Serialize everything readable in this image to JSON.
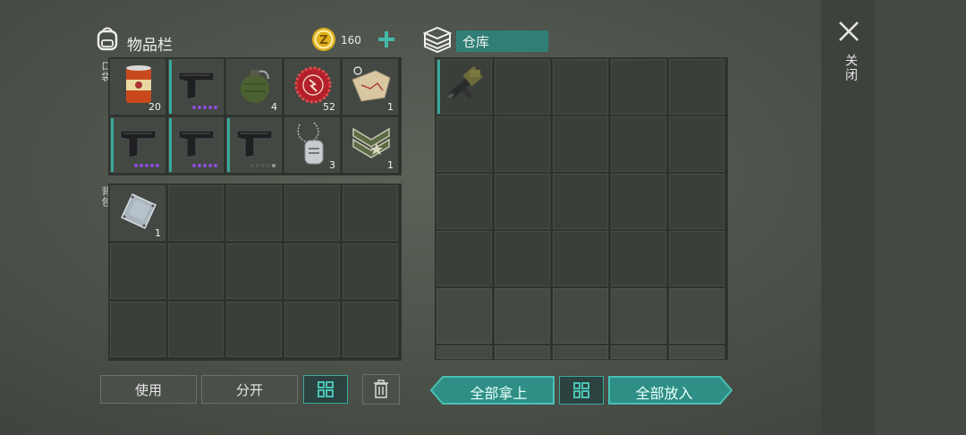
{
  "inventory": {
    "title": "物品栏",
    "coins": "160",
    "pocket_label": "口袋",
    "backpack_label": "背包",
    "pocket_slots": [
      {
        "item": "canned-food",
        "qty": "20",
        "selected": false,
        "dots": []
      },
      {
        "item": "pistol",
        "qty": "",
        "selected": true,
        "dots": [
          "#8a4fd8",
          "#8a4fd8",
          "#8a4fd8",
          "#8a4fd8",
          "#8a4fd8"
        ]
      },
      {
        "item": "grenade",
        "qty": "4",
        "selected": false,
        "dots": []
      },
      {
        "item": "bottle-cap",
        "qty": "52",
        "selected": false,
        "dots": []
      },
      {
        "item": "map-fragment",
        "qty": "1",
        "selected": false,
        "dots": []
      },
      {
        "item": "pistol",
        "qty": "",
        "selected": true,
        "dots": [
          "#8a4fd8",
          "#8a4fd8",
          "#8a4fd8",
          "#8a4fd8",
          "#8a4fd8"
        ]
      },
      {
        "item": "pistol",
        "qty": "",
        "selected": true,
        "dots": [
          "#8a4fd8",
          "#8a4fd8",
          "#8a4fd8",
          "#8a4fd8",
          "#8a4fd8"
        ]
      },
      {
        "item": "pistol",
        "qty": "",
        "selected": true,
        "dots": [
          "#555555",
          "#555555",
          "#555555",
          "#555555",
          "#999999"
        ]
      },
      {
        "item": "dog-tag",
        "qty": "3",
        "selected": false,
        "dots": []
      },
      {
        "item": "rank-badge",
        "qty": "1",
        "selected": false,
        "dots": []
      }
    ],
    "backpack_first": {
      "item": "metal-plate",
      "qty": "1"
    }
  },
  "storage": {
    "title": "仓库",
    "first_item": "machine-gun"
  },
  "buttons": {
    "use": "使用",
    "split": "分开",
    "take_all": "全部拿上",
    "put_all": "全部放入",
    "close": "关闭"
  },
  "colors": {
    "accent": "#3aa89c",
    "purple_dot": "#8a4fd8",
    "coin": "#e0b020"
  }
}
